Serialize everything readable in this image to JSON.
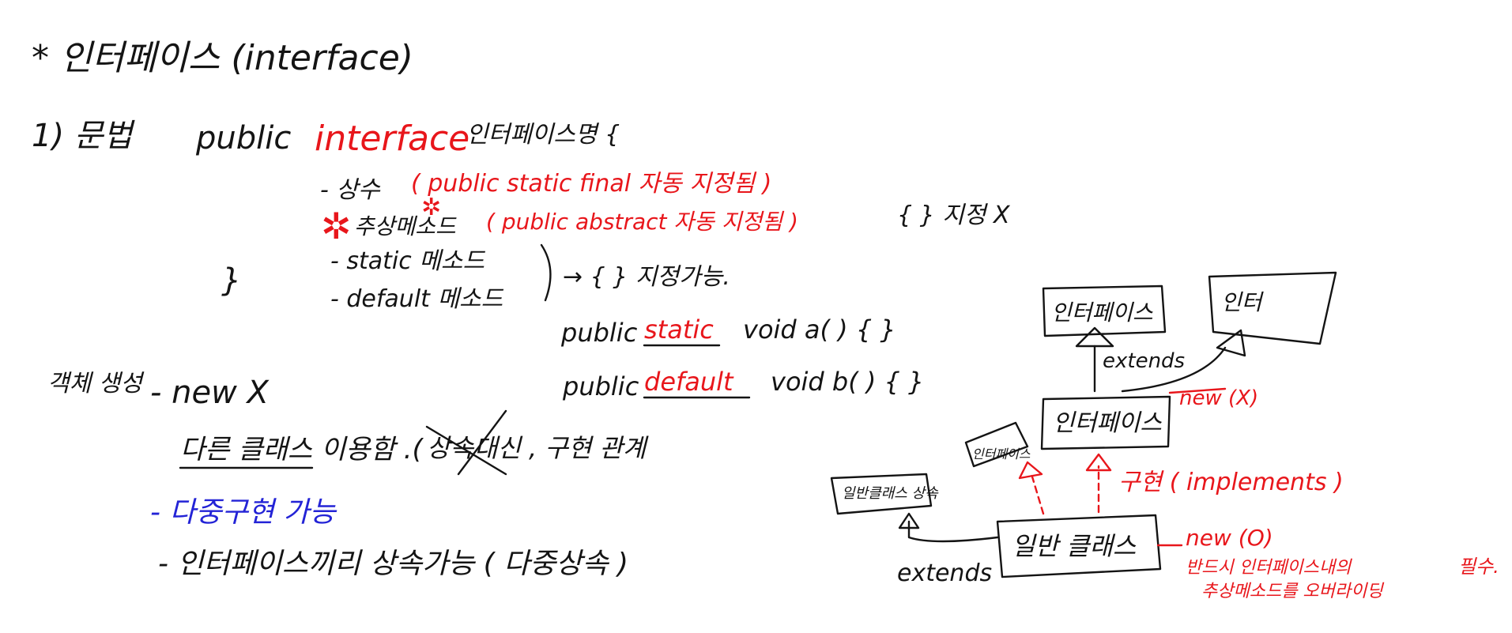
{
  "title": "* 인터페이스 (interface)",
  "syntax": {
    "label": "1) 문법",
    "public_kw": "public",
    "interface_kw": "interface",
    "name_brace": "인터페이스명 {",
    "close_brace": "}",
    "constant_item": "- 상수",
    "constant_note": "( public static final 자동 지정됨 )",
    "abstract_item": "추상메소드",
    "abstract_note": "( public abstract 자동 지정됨 )",
    "abstract_side_note": "{ } 지정 X",
    "static_item": "- static 메소드",
    "default_item": "- default 메소드",
    "body_note": "→ { } 지정가능.",
    "static_example_public": "public",
    "static_example_kw": "static",
    "static_example_rest": "void a( ) { }",
    "default_example_public": "public",
    "default_example_kw": "default",
    "default_example_rest": "void b( ) { }"
  },
  "features": {
    "label": "객체 생성",
    "new_line": "- new X",
    "other_class_line": "다른 클래스 이용함 .(",
    "inherit_struck": "상속",
    "other_class_rest": "대신 , 구현 관계",
    "multi_impl": "- 다중구현 가능",
    "multi_inherit": "- 인터페이스끼리 상속가능 ( 다중상속 )"
  },
  "diagram": {
    "iface_top_left": "인터페이스",
    "iface_top_right": "인터",
    "extends_top": "extends",
    "iface_center": "인터페이스",
    "new_x": "new (X)",
    "abstract_class_box": "일반클래스 상속",
    "impl_box_small": "인터페이스",
    "impl_label": "구현 ( implements )",
    "general_class": "일반 클래스",
    "extends_bottom": "extends",
    "new_o": "new (O)",
    "note_line1": "반드시 인터페이스내의",
    "note_line2": "추상메소드를 오버라이딩",
    "note_line3": "필수."
  }
}
